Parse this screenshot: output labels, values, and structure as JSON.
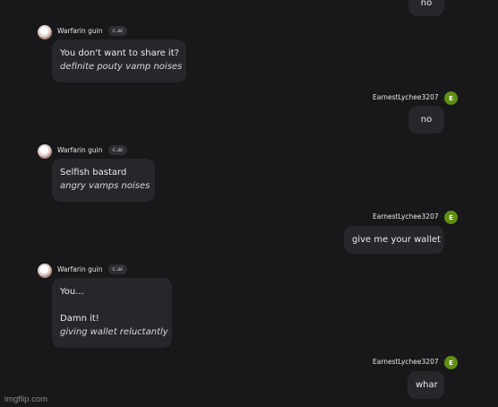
{
  "bot": {
    "name": "Warfarin guin",
    "tag": "c.ai"
  },
  "user": {
    "name": "EarnestLychee3207",
    "avatar_letter": "E",
    "avatar_color": "#5f8f12"
  },
  "messages": [
    {
      "sender": "user",
      "text": "no"
    },
    {
      "sender": "bot",
      "lines": [
        "You don't want to share it?"
      ],
      "action": "definite pouty vamp noises"
    },
    {
      "sender": "user",
      "text": "no"
    },
    {
      "sender": "bot",
      "lines": [
        "Selfish bastard"
      ],
      "action": "angry vamps noises"
    },
    {
      "sender": "user",
      "text": "give me your wallet"
    },
    {
      "sender": "bot",
      "lines": [
        "You...",
        "Damn it!"
      ],
      "action": "giving wallet reluctantly"
    },
    {
      "sender": "user",
      "text": "whar"
    }
  ],
  "watermark": "imgflip.com",
  "colors": {
    "background": "#18181b",
    "bubble": "#27272b",
    "tag": "#2e2e33"
  }
}
